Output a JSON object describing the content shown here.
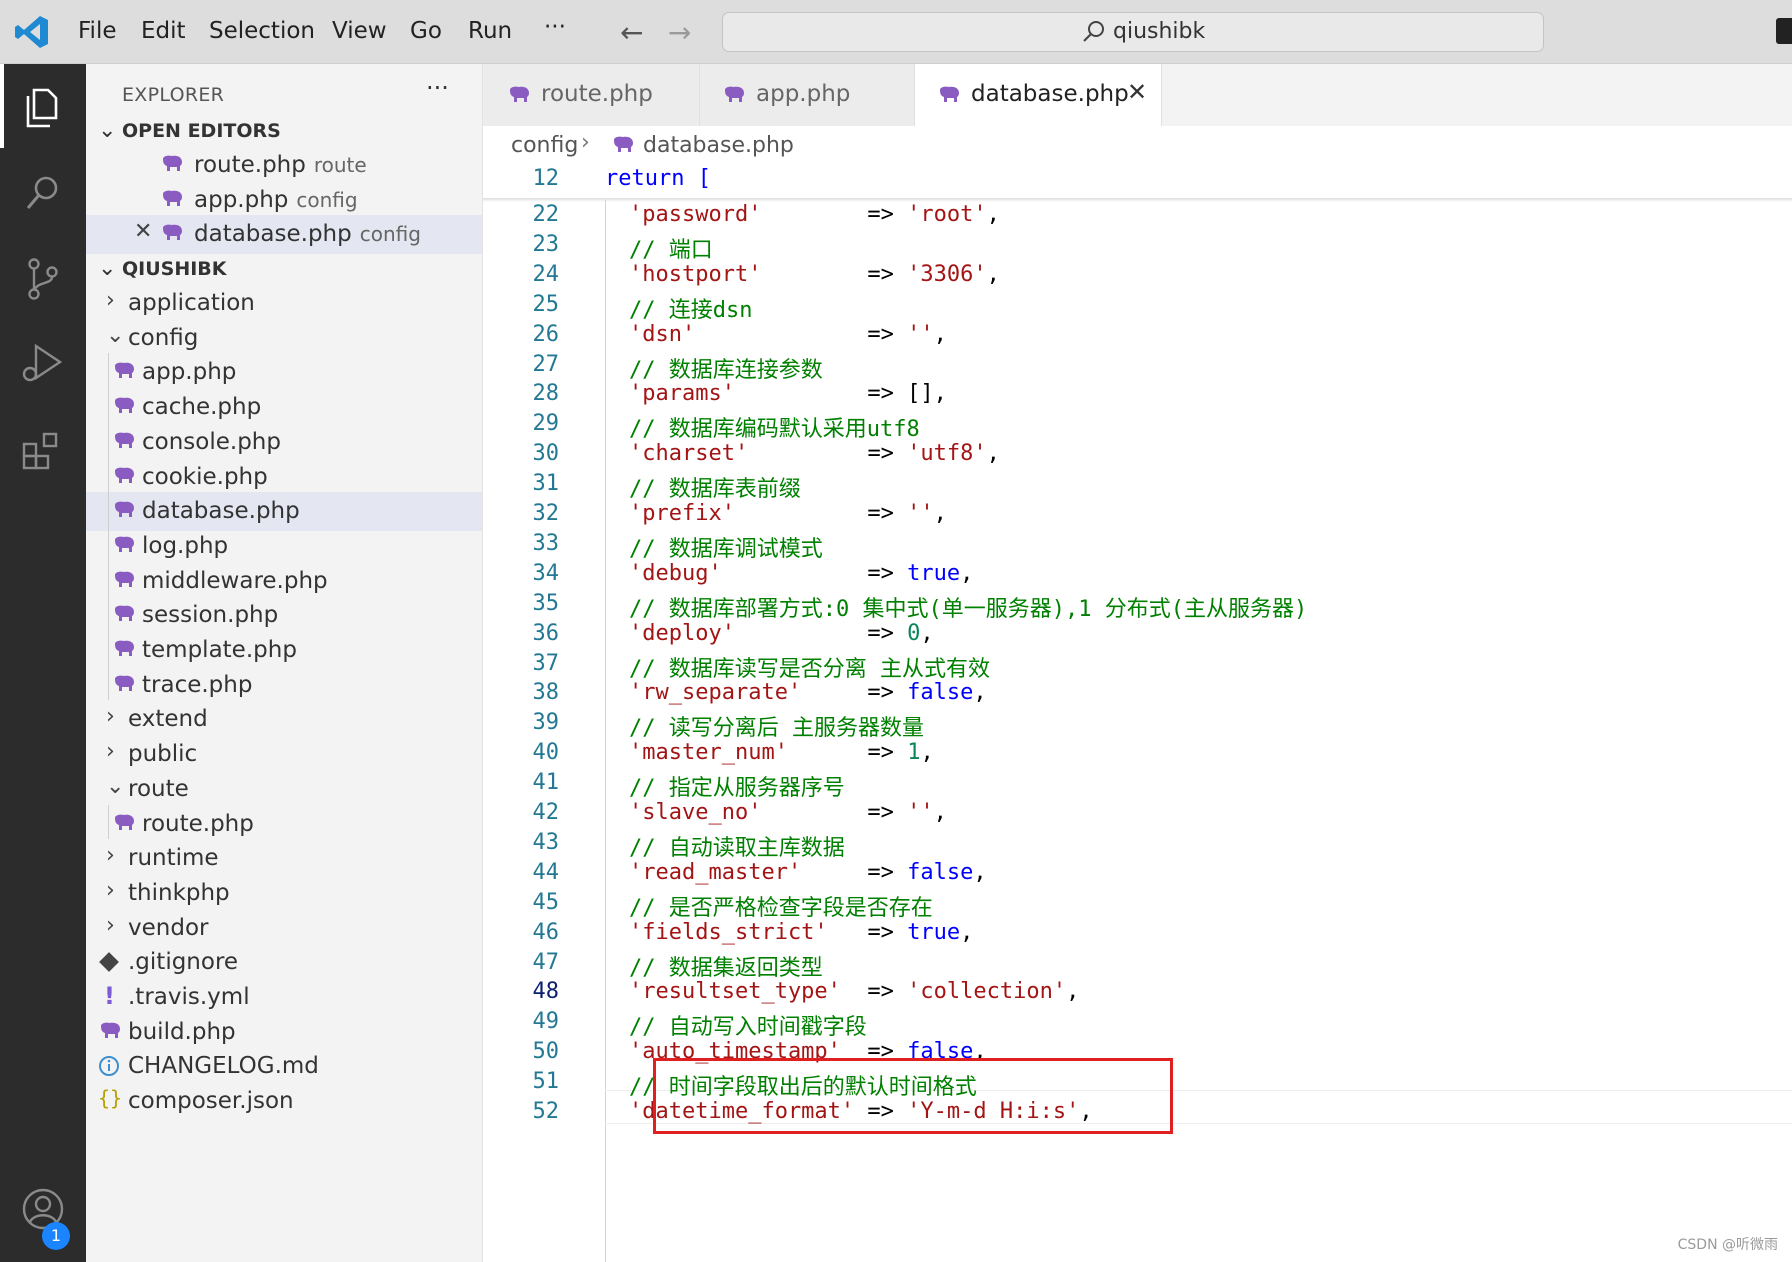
{
  "menu": [
    "File",
    "Edit",
    "Selection",
    "View",
    "Go",
    "Run",
    "···"
  ],
  "command_center": "qiushibk",
  "activity_badge": "1",
  "explorer": {
    "title": "EXPLORER",
    "more": "···",
    "open_editors_label": "OPEN EDITORS",
    "open_editors": [
      {
        "name": "route.php",
        "desc": "route"
      },
      {
        "name": "app.php",
        "desc": "config"
      },
      {
        "name": "database.php",
        "desc": "config",
        "active": true
      }
    ],
    "workspace_label": "QIUSHIBK",
    "tree": [
      {
        "name": "application",
        "type": "folder",
        "open": false
      },
      {
        "name": "config",
        "type": "folder",
        "open": true
      },
      {
        "name": "app.php",
        "type": "php"
      },
      {
        "name": "cache.php",
        "type": "php"
      },
      {
        "name": "console.php",
        "type": "php"
      },
      {
        "name": "cookie.php",
        "type": "php"
      },
      {
        "name": "database.php",
        "type": "php",
        "selected": true
      },
      {
        "name": "log.php",
        "type": "php"
      },
      {
        "name": "middleware.php",
        "type": "php"
      },
      {
        "name": "session.php",
        "type": "php"
      },
      {
        "name": "template.php",
        "type": "php"
      },
      {
        "name": "trace.php",
        "type": "php"
      },
      {
        "name": "extend",
        "type": "folder",
        "open": false
      },
      {
        "name": "public",
        "type": "folder",
        "open": false
      },
      {
        "name": "route",
        "type": "folder",
        "open": true
      },
      {
        "name": "route.php",
        "type": "php"
      },
      {
        "name": "runtime",
        "type": "folder",
        "open": false
      },
      {
        "name": "thinkphp",
        "type": "folder",
        "open": false
      },
      {
        "name": "vendor",
        "type": "folder",
        "open": false
      },
      {
        "name": ".gitignore",
        "type": "git"
      },
      {
        "name": ".travis.yml",
        "type": "yml"
      },
      {
        "name": "build.php",
        "type": "php"
      },
      {
        "name": "CHANGELOG.md",
        "type": "md"
      },
      {
        "name": "composer.json",
        "type": "json"
      }
    ]
  },
  "tabs": [
    {
      "label": "route.php",
      "active": false
    },
    {
      "label": "app.php",
      "active": false
    },
    {
      "label": "database.php",
      "active": true
    }
  ],
  "breadcrumb": {
    "folder": "config",
    "separator": "›",
    "file": "database.php"
  },
  "editor": {
    "sticky": {
      "line": "12",
      "code": "return ["
    },
    "current_line": "48",
    "lines": [
      {
        "n": "22",
        "key": "'password'",
        "pad": "        ",
        "val": "'root'",
        "vt": "s"
      },
      {
        "n": "23",
        "comment": "// 端口"
      },
      {
        "n": "24",
        "key": "'hostport'",
        "pad": "        ",
        "val": "'3306'",
        "vt": "s"
      },
      {
        "n": "25",
        "comment": "// 连接dsn"
      },
      {
        "n": "26",
        "key": "'dsn'",
        "pad": "             ",
        "val": "''",
        "vt": "s"
      },
      {
        "n": "27",
        "comment": "// 数据库连接参数"
      },
      {
        "n": "28",
        "key": "'params'",
        "pad": "          ",
        "val": "[]",
        "vt": "p"
      },
      {
        "n": "29",
        "comment": "// 数据库编码默认采用utf8"
      },
      {
        "n": "30",
        "key": "'charset'",
        "pad": "         ",
        "val": "'utf8'",
        "vt": "s"
      },
      {
        "n": "31",
        "comment": "// 数据库表前缀"
      },
      {
        "n": "32",
        "key": "'prefix'",
        "pad": "          ",
        "val": "''",
        "vt": "s"
      },
      {
        "n": "33",
        "comment": "// 数据库调试模式"
      },
      {
        "n": "34",
        "key": "'debug'",
        "pad": "           ",
        "val": "true",
        "vt": "k"
      },
      {
        "n": "35",
        "comment": "// 数据库部署方式:0 集中式(单一服务器),1 分布式(主从服务器)"
      },
      {
        "n": "36",
        "key": "'deploy'",
        "pad": "          ",
        "val": "0",
        "vt": "n"
      },
      {
        "n": "37",
        "comment": "// 数据库读写是否分离 主从式有效"
      },
      {
        "n": "38",
        "key": "'rw_separate'",
        "pad": "     ",
        "val": "false",
        "vt": "k"
      },
      {
        "n": "39",
        "comment": "// 读写分离后 主服务器数量"
      },
      {
        "n": "40",
        "key": "'master_num'",
        "pad": "      ",
        "val": "1",
        "vt": "n"
      },
      {
        "n": "41",
        "comment": "// 指定从服务器序号"
      },
      {
        "n": "42",
        "key": "'slave_no'",
        "pad": "        ",
        "val": "''",
        "vt": "s"
      },
      {
        "n": "43",
        "comment": "// 自动读取主库数据"
      },
      {
        "n": "44",
        "key": "'read_master'",
        "pad": "     ",
        "val": "false",
        "vt": "k"
      },
      {
        "n": "45",
        "comment": "// 是否严格检查字段是否存在"
      },
      {
        "n": "46",
        "key": "'fields_strict'",
        "pad": "   ",
        "val": "true",
        "vt": "k"
      },
      {
        "n": "47",
        "comment": "// 数据集返回类型"
      },
      {
        "n": "48",
        "key": "'resultset_type'",
        "pad": "  ",
        "val": "'collection'",
        "vt": "s"
      },
      {
        "n": "49",
        "comment": "// 自动写入时间戳字段"
      },
      {
        "n": "50",
        "key": "'auto_timestamp'",
        "pad": "  ",
        "val": "false",
        "vt": "k"
      },
      {
        "n": "51",
        "comment": "// 时间字段取出后的默认时间格式"
      },
      {
        "n": "52",
        "key": "'datetime_format'",
        "pad": " ",
        "val": "'Y-m-d H:i:s'",
        "vt": "s"
      }
    ]
  },
  "watermark": "CSDN @听微雨",
  "colors": {
    "string": "#a31515",
    "comment": "#008000",
    "keyword": "#0000ff",
    "number": "#098658",
    "highlight_box": "#e02020"
  }
}
